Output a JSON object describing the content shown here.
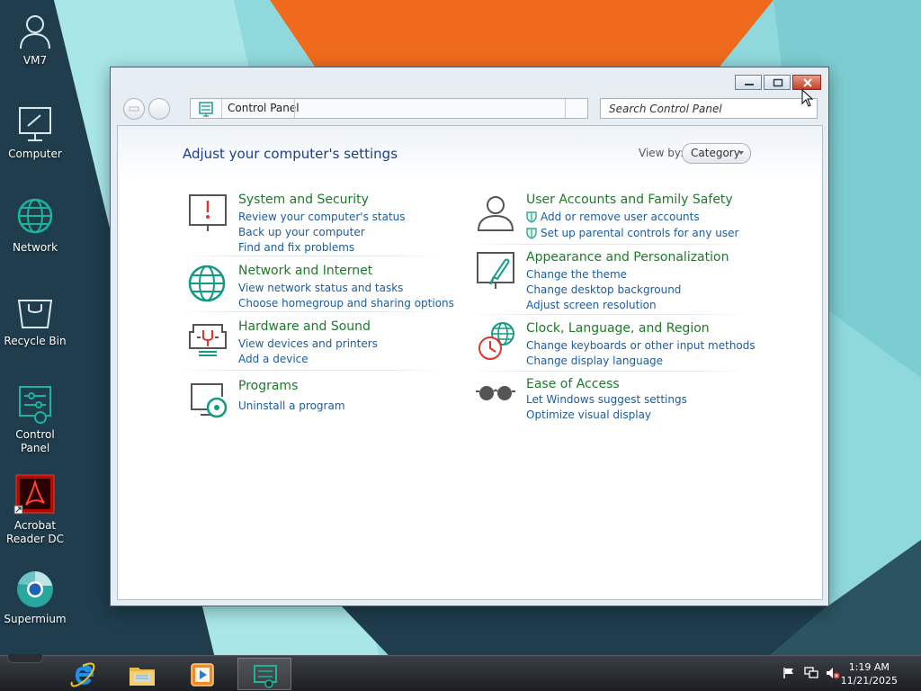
{
  "desktop": {
    "icons": [
      {
        "label": "VM7",
        "icon": "user-icon"
      },
      {
        "label": "Computer",
        "icon": "computer-icon"
      },
      {
        "label": "Network",
        "icon": "network-icon"
      },
      {
        "label": "Recycle Bin",
        "icon": "recycle-bin-icon"
      },
      {
        "label": "Control Panel",
        "icon": "control-panel-icon"
      },
      {
        "label": "Acrobat\nReader DC",
        "icon": "acrobat-reader-icon"
      },
      {
        "label": "Supermium",
        "icon": "supermium-browser-icon"
      }
    ]
  },
  "window": {
    "address": {
      "crumb": "Control Panel"
    },
    "search": {
      "placeholder": "Search Control Panel"
    },
    "title": "Adjust your computer's settings",
    "view_by": {
      "label": "View by:",
      "value": "Category"
    },
    "categories": [
      {
        "title": "System and Security",
        "icon": "system-security-icon",
        "links": [
          "Review your computer's status",
          "Back up your computer",
          "Find and fix problems"
        ]
      },
      {
        "title": "Network and Internet",
        "icon": "network-internet-icon",
        "links": [
          "View network status and tasks",
          "Choose homegroup and sharing options"
        ]
      },
      {
        "title": "Hardware and Sound",
        "icon": "hardware-sound-icon",
        "links": [
          "View devices and printers",
          "Add a device"
        ]
      },
      {
        "title": "Programs",
        "icon": "programs-icon",
        "links": [
          "Uninstall a program"
        ]
      },
      {
        "title": "User Accounts and Family Safety",
        "icon": "user-accounts-icon",
        "links": [
          "Add or remove user accounts",
          "Set up parental controls for any user"
        ]
      },
      {
        "title": "Appearance and Personalization",
        "icon": "appearance-icon",
        "links": [
          "Change the theme",
          "Change desktop background",
          "Adjust screen resolution"
        ]
      },
      {
        "title": "Clock, Language, and Region",
        "icon": "clock-language-icon",
        "links": [
          "Change keyboards or other input methods",
          "Change display language"
        ]
      },
      {
        "title": "Ease of Access",
        "icon": "ease-of-access-icon",
        "links": [
          "Let Windows suggest settings",
          "Optimize visual display"
        ]
      }
    ]
  },
  "taskbar": {
    "apps": [
      "internet-explorer-icon",
      "file-explorer-icon",
      "media-player-icon",
      "control-panel-icon"
    ],
    "clock": {
      "time": "1:19 AM",
      "date": "11/21/2025"
    }
  },
  "colors": {
    "wallpaper_light": "#8fd9dc",
    "wallpaper_dark": "#1f3d4d",
    "wallpaper_orange": "#ef6a1c",
    "category_title": "#1d7a2b",
    "link": "#1c5c9e",
    "accent_teal": "#129a83"
  }
}
